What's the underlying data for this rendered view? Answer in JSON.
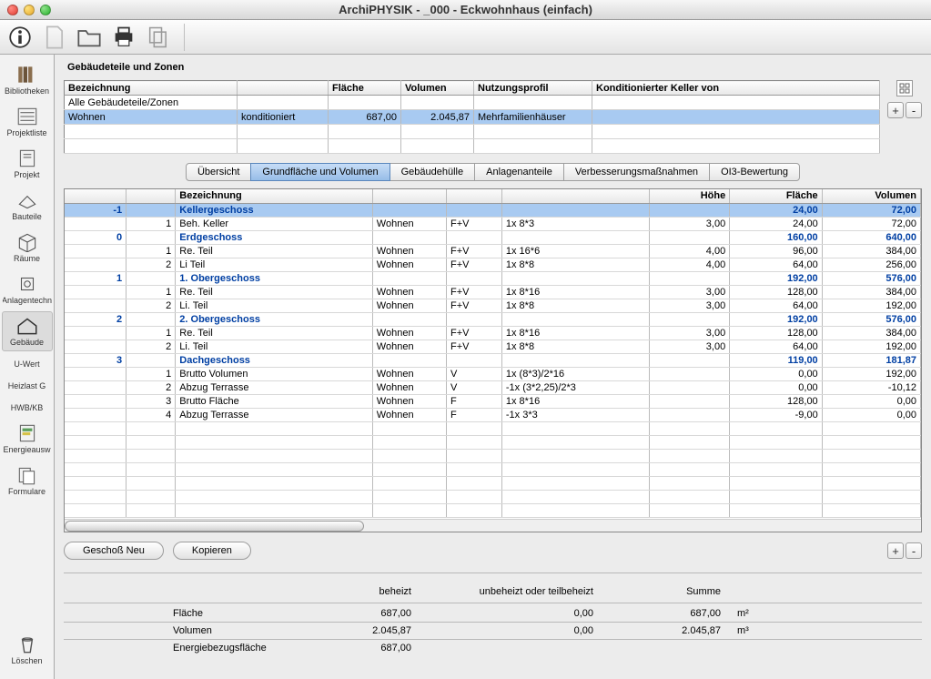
{
  "window": {
    "title": "ArchiPHYSIK - _000 - Eckwohnhaus (einfach)"
  },
  "sidebar": {
    "items": [
      {
        "label": "Bibliotheken"
      },
      {
        "label": "Projektliste"
      },
      {
        "label": "Projekt"
      },
      {
        "label": "Bauteile"
      },
      {
        "label": "Räume"
      },
      {
        "label": "Anlagentechn"
      },
      {
        "label": "Gebäude"
      },
      {
        "label": "U-Wert"
      },
      {
        "label": "Heizlast G"
      },
      {
        "label": "HWB/KB"
      },
      {
        "label": "Energieausw"
      },
      {
        "label": "Formulare"
      }
    ],
    "bottom": {
      "label": "Löschen"
    }
  },
  "zones": {
    "title": "Gebäudeteile und Zonen",
    "headers": {
      "bezeichnung": "Bezeichnung",
      "col2": "",
      "flaeche": "Fläche",
      "volumen": "Volumen",
      "nutzungsprofil": "Nutzungsprofil",
      "keller": "Konditionierter Keller von"
    },
    "rows": [
      {
        "bezeichnung": "Alle Gebäudeteile/Zonen",
        "kond": "",
        "flaeche": "",
        "volumen": "",
        "profil": "",
        "keller": ""
      },
      {
        "bezeichnung": "Wohnen",
        "kond": "konditioniert",
        "flaeche": "687,00",
        "volumen": "2.045,87",
        "profil": "Mehrfamilienhäuser",
        "keller": "",
        "selected": true
      }
    ]
  },
  "tabs": [
    {
      "label": "Übersicht"
    },
    {
      "label": "Grundfläche und Volumen",
      "active": true
    },
    {
      "label": "Gebäudehülle"
    },
    {
      "label": "Anlagenanteile"
    },
    {
      "label": "Verbesserungsmaßnahmen"
    },
    {
      "label": "OI3-Bewertung"
    }
  ],
  "detail": {
    "headers": {
      "nr": "",
      "sub": "",
      "bezeichnung": "Bezeichnung",
      "zone": "",
      "typ": "",
      "formel": "",
      "hoehe": "Höhe",
      "flaeche": "Fläche",
      "volumen": "Volumen"
    },
    "rows": [
      {
        "level": true,
        "selected": true,
        "nr": "-1",
        "bez": "Kellergeschoss",
        "flaeche": "24,00",
        "volumen": "72,00"
      },
      {
        "sub": "1",
        "bez": "Beh. Keller",
        "zone": "Wohnen",
        "typ": "F+V",
        "formel": "1x  8*3",
        "hoehe": "3,00",
        "flaeche": "24,00",
        "volumen": "72,00"
      },
      {
        "level": true,
        "nr": "0",
        "bez": "Erdgeschoss",
        "flaeche": "160,00",
        "volumen": "640,00"
      },
      {
        "sub": "1",
        "bez": "Re. Teil",
        "zone": "Wohnen",
        "typ": "F+V",
        "formel": "1x  16*6",
        "hoehe": "4,00",
        "flaeche": "96,00",
        "volumen": "384,00"
      },
      {
        "sub": "2",
        "bez": "Li Teil",
        "zone": "Wohnen",
        "typ": "F+V",
        "formel": "1x  8*8",
        "hoehe": "4,00",
        "flaeche": "64,00",
        "volumen": "256,00"
      },
      {
        "level": true,
        "nr": "1",
        "bez": "1. Obergeschoss",
        "flaeche": "192,00",
        "volumen": "576,00"
      },
      {
        "sub": "1",
        "bez": "Re. Teil",
        "zone": "Wohnen",
        "typ": "F+V",
        "formel": "1x  8*16",
        "hoehe": "3,00",
        "flaeche": "128,00",
        "volumen": "384,00"
      },
      {
        "sub": "2",
        "bez": "Li. Teil",
        "zone": "Wohnen",
        "typ": "F+V",
        "formel": "1x  8*8",
        "hoehe": "3,00",
        "flaeche": "64,00",
        "volumen": "192,00"
      },
      {
        "level": true,
        "nr": "2",
        "bez": "2. Obergeschoss",
        "flaeche": "192,00",
        "volumen": "576,00"
      },
      {
        "sub": "1",
        "bez": "Re. Teil",
        "zone": "Wohnen",
        "typ": "F+V",
        "formel": "1x  8*16",
        "hoehe": "3,00",
        "flaeche": "128,00",
        "volumen": "384,00"
      },
      {
        "sub": "2",
        "bez": "Li. Teil",
        "zone": "Wohnen",
        "typ": "F+V",
        "formel": "1x  8*8",
        "hoehe": "3,00",
        "flaeche": "64,00",
        "volumen": "192,00"
      },
      {
        "level": true,
        "nr": "3",
        "bez": "Dachgeschoss",
        "flaeche": "119,00",
        "volumen": "181,87"
      },
      {
        "sub": "1",
        "bez": "Brutto Volumen",
        "zone": "Wohnen",
        "typ": "V",
        "formel": "1x  (8*3)/2*16",
        "hoehe": "",
        "flaeche": "0,00",
        "volumen": "192,00"
      },
      {
        "sub": "2",
        "bez": "Abzug Terrasse",
        "zone": "Wohnen",
        "typ": "V",
        "formel": "-1x  (3*2,25)/2*3",
        "hoehe": "",
        "flaeche": "0,00",
        "volumen": "-10,12"
      },
      {
        "sub": "3",
        "bez": "Brutto Fläche",
        "zone": "Wohnen",
        "typ": "F",
        "formel": "1x  8*16",
        "hoehe": "",
        "flaeche": "128,00",
        "volumen": "0,00"
      },
      {
        "sub": "4",
        "bez": "Abzug Terrasse",
        "zone": "Wohnen",
        "typ": "F",
        "formel": "-1x  3*3",
        "hoehe": "",
        "flaeche": "-9,00",
        "volumen": "0,00"
      }
    ]
  },
  "buttons": {
    "geschoss_neu": "Geschoß Neu",
    "kopieren": "Kopieren"
  },
  "summary": {
    "head": {
      "beheizt": "beheizt",
      "unbeheizt": "unbeheizt  oder teilbeheizt",
      "summe": "Summe"
    },
    "rows": [
      {
        "label": "Fläche",
        "beheizt": "687,00",
        "unbeheizt": "0,00",
        "summe": "687,00",
        "unit": "m²"
      },
      {
        "label": "Volumen",
        "beheizt": "2.045,87",
        "unbeheizt": "0,00",
        "summe": "2.045,87",
        "unit": "m³"
      },
      {
        "label": "Energiebezugsfläche",
        "beheizt": "687,00",
        "unbeheizt": "",
        "summe": "",
        "unit": ""
      }
    ]
  }
}
